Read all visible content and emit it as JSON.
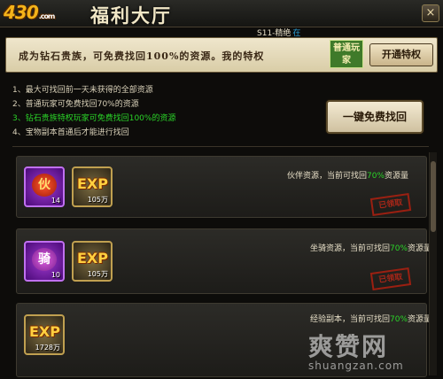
{
  "header": {
    "logo_text": "430",
    "logo_suffix": ".com",
    "title": "福利大厅",
    "close_glyph": "×"
  },
  "subtab": {
    "label": "S11-精绝",
    "after": "在"
  },
  "banner": {
    "text": "成为钻石贵族，可免费找回100%的资源。我的特权",
    "badge": "普通玩家",
    "open_button": "开通特权"
  },
  "info_lines": [
    "1、最大可找回前一天未获得的全部资源",
    "2、普通玩家可免费找回70%的资源",
    "3、钻石贵族特权玩家可免费找回100%的资源",
    "4、宝物副本首通后才能进行找回"
  ],
  "recover_button": "一键免费找回",
  "resources": [
    {
      "name_text": "伙伴资源，当前可找回",
      "pct": "70%",
      "suffix": "资源量",
      "stamp": "已领取",
      "items": [
        {
          "glyph": "伙",
          "count": "14",
          "kind": "purple"
        },
        {
          "glyph": "EXP",
          "count": "105万",
          "kind": "gold"
        }
      ]
    },
    {
      "name_text": "坐骑资源，当前可找回",
      "pct": "70%",
      "suffix": "资源量",
      "stamp": "已领取",
      "items": [
        {
          "glyph": "骑",
          "count": "10",
          "kind": "purple"
        },
        {
          "glyph": "EXP",
          "count": "105万",
          "kind": "gold"
        }
      ]
    },
    {
      "name_text": "经验副本，当前可找回",
      "pct": "70%",
      "suffix": "资源量",
      "items": [
        {
          "glyph": "EXP",
          "count": "1728万",
          "kind": "gold"
        }
      ]
    }
  ],
  "watermark": {
    "main": "爽赞网",
    "sub": "shuangzan.com"
  }
}
